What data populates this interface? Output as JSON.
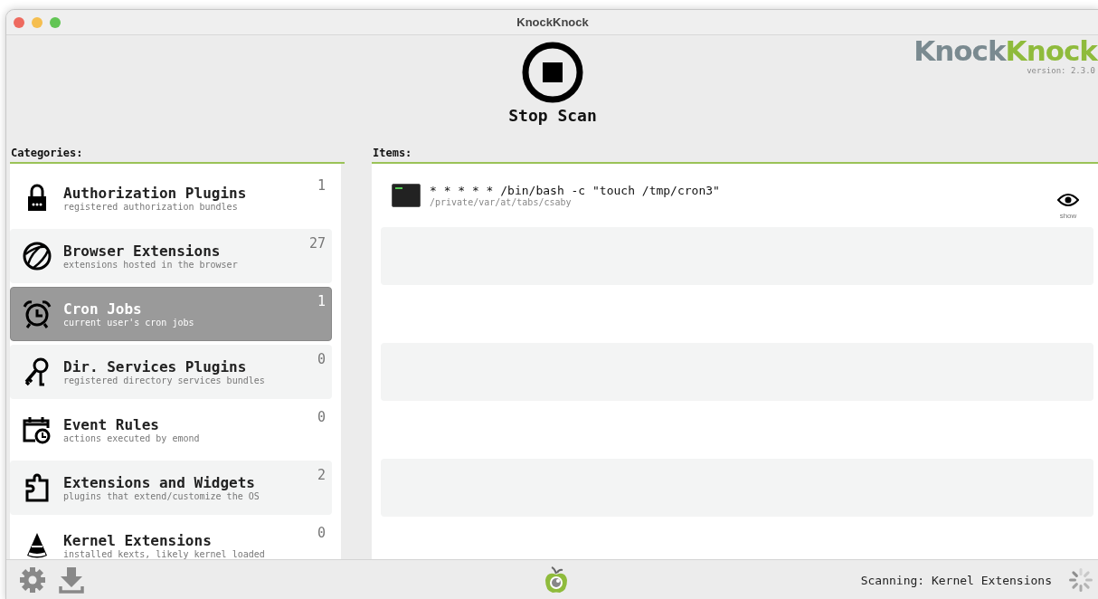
{
  "window": {
    "title": "KnockKnock"
  },
  "scan_button": {
    "label": "Stop Scan"
  },
  "logo": {
    "part_1": "Knock",
    "part_2": "Knock",
    "version": "version: 2.3.0"
  },
  "categories": {
    "heading": "Categories:",
    "items": [
      {
        "name": "Authorization Plugins",
        "description": "registered authorization bundles",
        "count": "1",
        "selected": false
      },
      {
        "name": "Browser Extensions",
        "description": "extensions hosted in the browser",
        "count": "27",
        "selected": false
      },
      {
        "name": "Cron Jobs",
        "description": "current user's cron jobs",
        "count": "1",
        "selected": true
      },
      {
        "name": "Dir. Services Plugins",
        "description": "registered directory services bundles",
        "count": "0",
        "selected": false
      },
      {
        "name": "Event Rules",
        "description": "actions executed by emond",
        "count": "0",
        "selected": false
      },
      {
        "name": "Extensions and Widgets",
        "description": "plugins that extend/customize the OS",
        "count": "2",
        "selected": false
      },
      {
        "name": "Kernel Extensions",
        "description": "installed kexts, likely kernel loaded",
        "count": "0",
        "selected": false
      }
    ]
  },
  "items": {
    "heading": "Items:",
    "rows": [
      {
        "command": "* * * * * /bin/bash -c \"touch /tmp/cron3\"",
        "path": "/private/var/at/tabs/csaby",
        "action": "show"
      }
    ]
  },
  "status_bar": {
    "text": "Scanning: Kernel Extensions"
  }
}
